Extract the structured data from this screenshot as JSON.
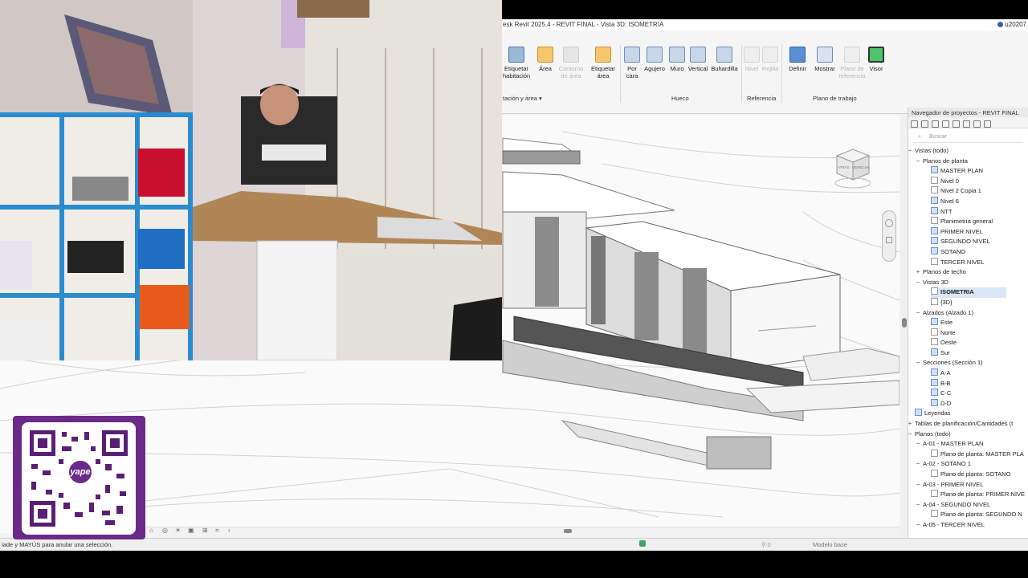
{
  "window": {
    "title": "esk Revit 2025.4 - REVIT FINAL - Vista 3D: ISOMETRIA",
    "user": "u20207"
  },
  "ribbon": {
    "buttons": [
      {
        "label": "Etiquetar habitación",
        "disabled": false
      },
      {
        "label": "Área",
        "disabled": false
      },
      {
        "label": "Contorno de área",
        "disabled": true
      },
      {
        "label": "Etiquetar área",
        "disabled": false
      },
      {
        "label": "Por cara",
        "disabled": false
      },
      {
        "label": "Agujero",
        "disabled": false
      },
      {
        "label": "Muro",
        "disabled": false
      },
      {
        "label": "Vertical",
        "disabled": false
      },
      {
        "label": "Buhardilla",
        "disabled": false
      },
      {
        "label": "Nivel",
        "disabled": true
      },
      {
        "label": "Rejilla",
        "disabled": true
      },
      {
        "label": "Definir",
        "disabled": false
      },
      {
        "label": "Mostrar",
        "disabled": false
      },
      {
        "label": "Plano de referencia",
        "disabled": true
      },
      {
        "label": "Visor",
        "disabled": false
      }
    ],
    "groups": [
      "tación y área",
      "Hueco",
      "Referencia",
      "Plano de trabajo"
    ]
  },
  "viewcube": {
    "face_label": "DERECHA",
    "side_label": "ATRÁS"
  },
  "project_browser": {
    "title": "Navegador de proyectos - REVIT FINAL",
    "search_placeholder": "Buscar",
    "items": [
      {
        "label": "Vistas (todo)",
        "level": 0,
        "toggle": "−"
      },
      {
        "label": "Planos de planta",
        "level": 1,
        "toggle": "−"
      },
      {
        "label": "MASTER PLAN",
        "level": 2,
        "icon": "view"
      },
      {
        "label": "Nivel 0",
        "level": 2,
        "icon": "empty"
      },
      {
        "label": "Nivel 2 Copia 1",
        "level": 2,
        "icon": "empty"
      },
      {
        "label": "Nivel 6",
        "level": 2,
        "icon": "view"
      },
      {
        "label": "NTT",
        "level": 2,
        "icon": "view"
      },
      {
        "label": "Planimetría general",
        "level": 2,
        "icon": "empty"
      },
      {
        "label": "PRIMER NIVEL",
        "level": 2,
        "icon": "view"
      },
      {
        "label": "SEGUNDO NIVEL",
        "level": 2,
        "icon": "view"
      },
      {
        "label": "SOTANO",
        "level": 2,
        "icon": "view"
      },
      {
        "label": "TERCER NIVEL",
        "level": 2,
        "icon": "empty"
      },
      {
        "label": "Planos de techo",
        "level": 1,
        "toggle": "+"
      },
      {
        "label": "Vistas 3D",
        "level": 1,
        "toggle": "−"
      },
      {
        "label": "ISOMETRIA",
        "level": 2,
        "icon": "empty",
        "selected": true
      },
      {
        "label": "{3D}",
        "level": 2,
        "icon": "empty"
      },
      {
        "label": "Alzados (Alzado 1)",
        "level": 1,
        "toggle": "−"
      },
      {
        "label": "Este",
        "level": 2,
        "icon": "view"
      },
      {
        "label": "Norte",
        "level": 2,
        "icon": "empty"
      },
      {
        "label": "Oeste",
        "level": 2,
        "icon": "empty"
      },
      {
        "label": "Sur",
        "level": 2,
        "icon": "view"
      },
      {
        "label": "Secciones (Sección 1)",
        "level": 1,
        "toggle": "−"
      },
      {
        "label": "A-A",
        "level": 2,
        "icon": "view"
      },
      {
        "label": "B-B",
        "level": 2,
        "icon": "view"
      },
      {
        "label": "C-C",
        "level": 2,
        "icon": "view"
      },
      {
        "label": "D-D",
        "level": 2,
        "icon": "view"
      },
      {
        "label": "Leyendas",
        "level": 0,
        "icon": "view"
      },
      {
        "label": "Tablas de planificación/Cantidades (t",
        "level": 0,
        "toggle": "+"
      },
      {
        "label": "Planos (todo)",
        "level": 0,
        "toggle": "−"
      },
      {
        "label": "A-01 - MASTER PLAN",
        "level": 1,
        "toggle": "−"
      },
      {
        "label": "Plano de planta: MASTER PLA",
        "level": 2,
        "icon": "empty"
      },
      {
        "label": "A-02 - SOTANO 1",
        "level": 1,
        "toggle": "−"
      },
      {
        "label": "Plano de planta: SOTANO",
        "level": 2,
        "icon": "empty"
      },
      {
        "label": "A-03 - PRIMER NIVEL",
        "level": 1,
        "toggle": "−"
      },
      {
        "label": "Plano de planta: PRIMER NIVE",
        "level": 2,
        "icon": "empty"
      },
      {
        "label": "A-04 - SEGUNDO NIVEL",
        "level": 1,
        "toggle": "−"
      },
      {
        "label": "Plano de planta: SEGUNDO N",
        "level": 2,
        "icon": "empty"
      },
      {
        "label": "A-05 - TERCER NIVEL",
        "level": 1,
        "toggle": "−"
      }
    ]
  },
  "statusbar": {
    "message": "iade y MAYÚS para anular una selección.",
    "filter": ":0",
    "model": "Modelo base"
  },
  "qr_overlay": {
    "brand": "yape"
  },
  "colors": {
    "qr_frame": "#6a2a8a",
    "selection": "#dbe7f6"
  }
}
